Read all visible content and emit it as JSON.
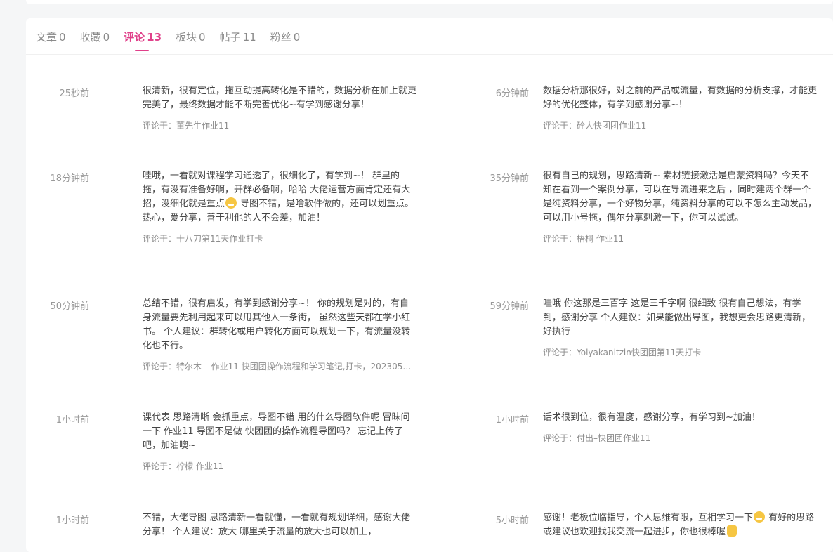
{
  "tabs": [
    {
      "label": "文章",
      "count": "0"
    },
    {
      "label": "收藏",
      "count": "0"
    },
    {
      "label": "评论",
      "count": "13"
    },
    {
      "label": "板块",
      "count": "0"
    },
    {
      "label": "帖子",
      "count": "11"
    },
    {
      "label": "粉丝",
      "count": "0"
    }
  ],
  "active_tab": "评论",
  "comments_left": [
    {
      "time": "25秒前",
      "text": "很清新，很有定位，拖互动提高转化是不错的，数据分析在加上就更完美了，最终数据才能不断完善优化~有学到感谢分享！",
      "ref": "评论于：董先生作业11"
    },
    {
      "time": "18分钟前",
      "text_a": "哇哦，一看就对课程学习通透了，很细化了，有学到~！ 群里的拖，有没有准备好啊，开群必备啊，哈哈 大佬运营方面肯定还有大招，没细化就是重点",
      "text_b": " 导图不错，是啥软件做的，还可以划重点。 热心，爱分享，善于利他的人不会差，加油！",
      "ref": "评论于：十八刀第11天作业打卡"
    },
    {
      "time": "50分钟前",
      "text": "总结不错，很有启发，有学到感谢分享~！ 你的规划是对的，有自身流量要先利用起来可以甩其他人一条街， 虽然这些天都在学小红书。 个人建议：群转化或用户转化方面可以规划一下，有流量没转化也不行。",
      "ref": "评论于：特尔木 – 作业11 快团团操作流程和学习笔记,打卡，202305…"
    },
    {
      "time": "1小时前",
      "text": "课代表 思路清晰 会抓重点，导图不错 用的什么导图软件呢 冒昧问一下 作业11 导图不是做 快团团的操作流程导图吗？ 忘记上传了吧，加油噢~",
      "ref": "评论于：柠檬 作业11"
    },
    {
      "time": "1小时前",
      "text": "不错，大佬导图 思路清新一看就懂，一看就有规划详细，感谢大佬分享！ 个人建议：放大 哪里关于流量的放大也可以加上，",
      "ref": ""
    }
  ],
  "comments_right": [
    {
      "time": "6分钟前",
      "text": "数据分析那很好，对之前的产品或流量，有数据的分析支撑，才能更好的优化整体，有学到感谢分享~！",
      "ref": "评论于：砼人快团团作业11"
    },
    {
      "time": "35分钟前",
      "text": "很有自己的规划，思路清新~ 素材链接激活是启蒙资料吗？今天不知在看到一个案例分享，可以在导流进来之后 ，同时建两个群一个是纯资料分享，一个好物分享，纯资料分享的可以不怎么主动发品，可以用小号拖，偶尔分享刺激一下，你可以试试。",
      "ref": "评论于：梧桐 作业11"
    },
    {
      "time": "59分钟前",
      "text": "哇哦 你这那是三百字 这是三千字啊 很细致 很有自己想法，有学到，感谢分享 个人建议：如果能做出导图，我想更会思路更清新，好执行",
      "ref": "评论于：Yolyakanitzin快团团第11天打卡"
    },
    {
      "time": "1小时前",
      "text": "话术很到位，很有温度，感谢分享，有学习到~加油！",
      "ref": "评论于：付出–快团团作业11"
    },
    {
      "time": "5小时前",
      "text_a": "感谢！老板位临指导，个人思维有限，互相学习一下",
      "text_b": " 有好的思路或建议也欢迎找我交流一起进步，你也很棒喔",
      "ref": ""
    }
  ]
}
